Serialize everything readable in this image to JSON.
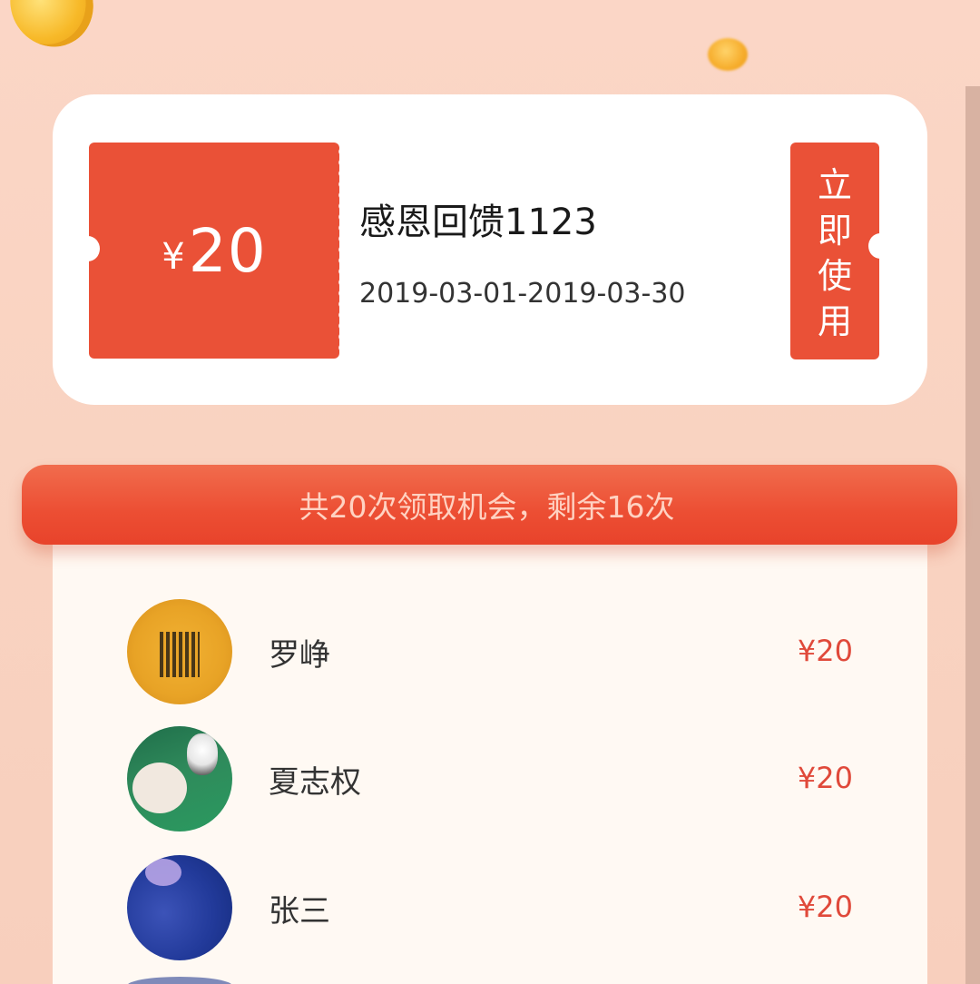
{
  "coupon": {
    "currency_symbol": "¥",
    "amount": "20",
    "title": "感恩回馈1123",
    "date_range": "2019-03-01-2019-03-30",
    "use_button_label": "立即使用"
  },
  "banner": {
    "text": "共20次领取机会，剩余16次"
  },
  "claims": [
    {
      "name": "罗峥",
      "amount": "¥20",
      "avatar": "avatar-gold-calligraphy"
    },
    {
      "name": "夏志权",
      "amount": "¥20",
      "avatar": "avatar-person-with-dog"
    },
    {
      "name": "张三",
      "amount": "¥20",
      "avatar": "avatar-blue-abstract"
    }
  ],
  "colors": {
    "accent": "#ea5137",
    "background": "#fbd6c6",
    "list_background": "#fff9f3",
    "amount_text": "#e0493a"
  }
}
